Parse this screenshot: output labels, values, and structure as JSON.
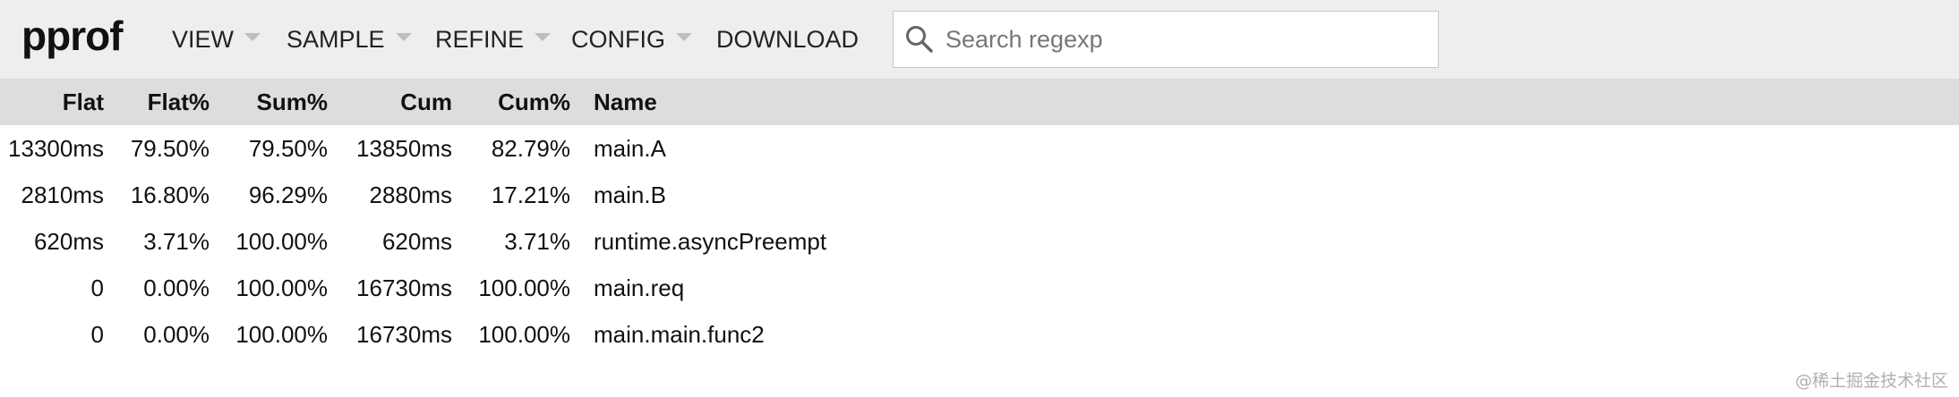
{
  "app": {
    "logo": "pprof"
  },
  "menu": {
    "view": "VIEW",
    "sample": "SAMPLE",
    "refine": "REFINE",
    "config": "CONFIG",
    "download": "DOWNLOAD"
  },
  "search": {
    "placeholder": "Search regexp",
    "value": ""
  },
  "table": {
    "headers": {
      "flat": "Flat",
      "flat_pct": "Flat%",
      "sum_pct": "Sum%",
      "cum": "Cum",
      "cum_pct": "Cum%",
      "name": "Name"
    },
    "rows": [
      {
        "flat": "13300ms",
        "flat_pct": "79.50%",
        "sum_pct": "79.50%",
        "cum": "13850ms",
        "cum_pct": "82.79%",
        "name": "main.A"
      },
      {
        "flat": "2810ms",
        "flat_pct": "16.80%",
        "sum_pct": "96.29%",
        "cum": "2880ms",
        "cum_pct": "17.21%",
        "name": "main.B"
      },
      {
        "flat": "620ms",
        "flat_pct": "3.71%",
        "sum_pct": "100.00%",
        "cum": "620ms",
        "cum_pct": "3.71%",
        "name": "runtime.asyncPreempt"
      },
      {
        "flat": "0",
        "flat_pct": "0.00%",
        "sum_pct": "100.00%",
        "cum": "16730ms",
        "cum_pct": "100.00%",
        "name": "main.req"
      },
      {
        "flat": "0",
        "flat_pct": "0.00%",
        "sum_pct": "100.00%",
        "cum": "16730ms",
        "cum_pct": "100.00%",
        "name": "main.main.func2"
      }
    ]
  },
  "watermark": "@稀土掘金技术社区",
  "icons": {
    "search": "search-icon",
    "caret": "caret-down-icon"
  },
  "colors": {
    "header_bg": "#eeeeee",
    "table_header_bg": "#dddddd"
  }
}
